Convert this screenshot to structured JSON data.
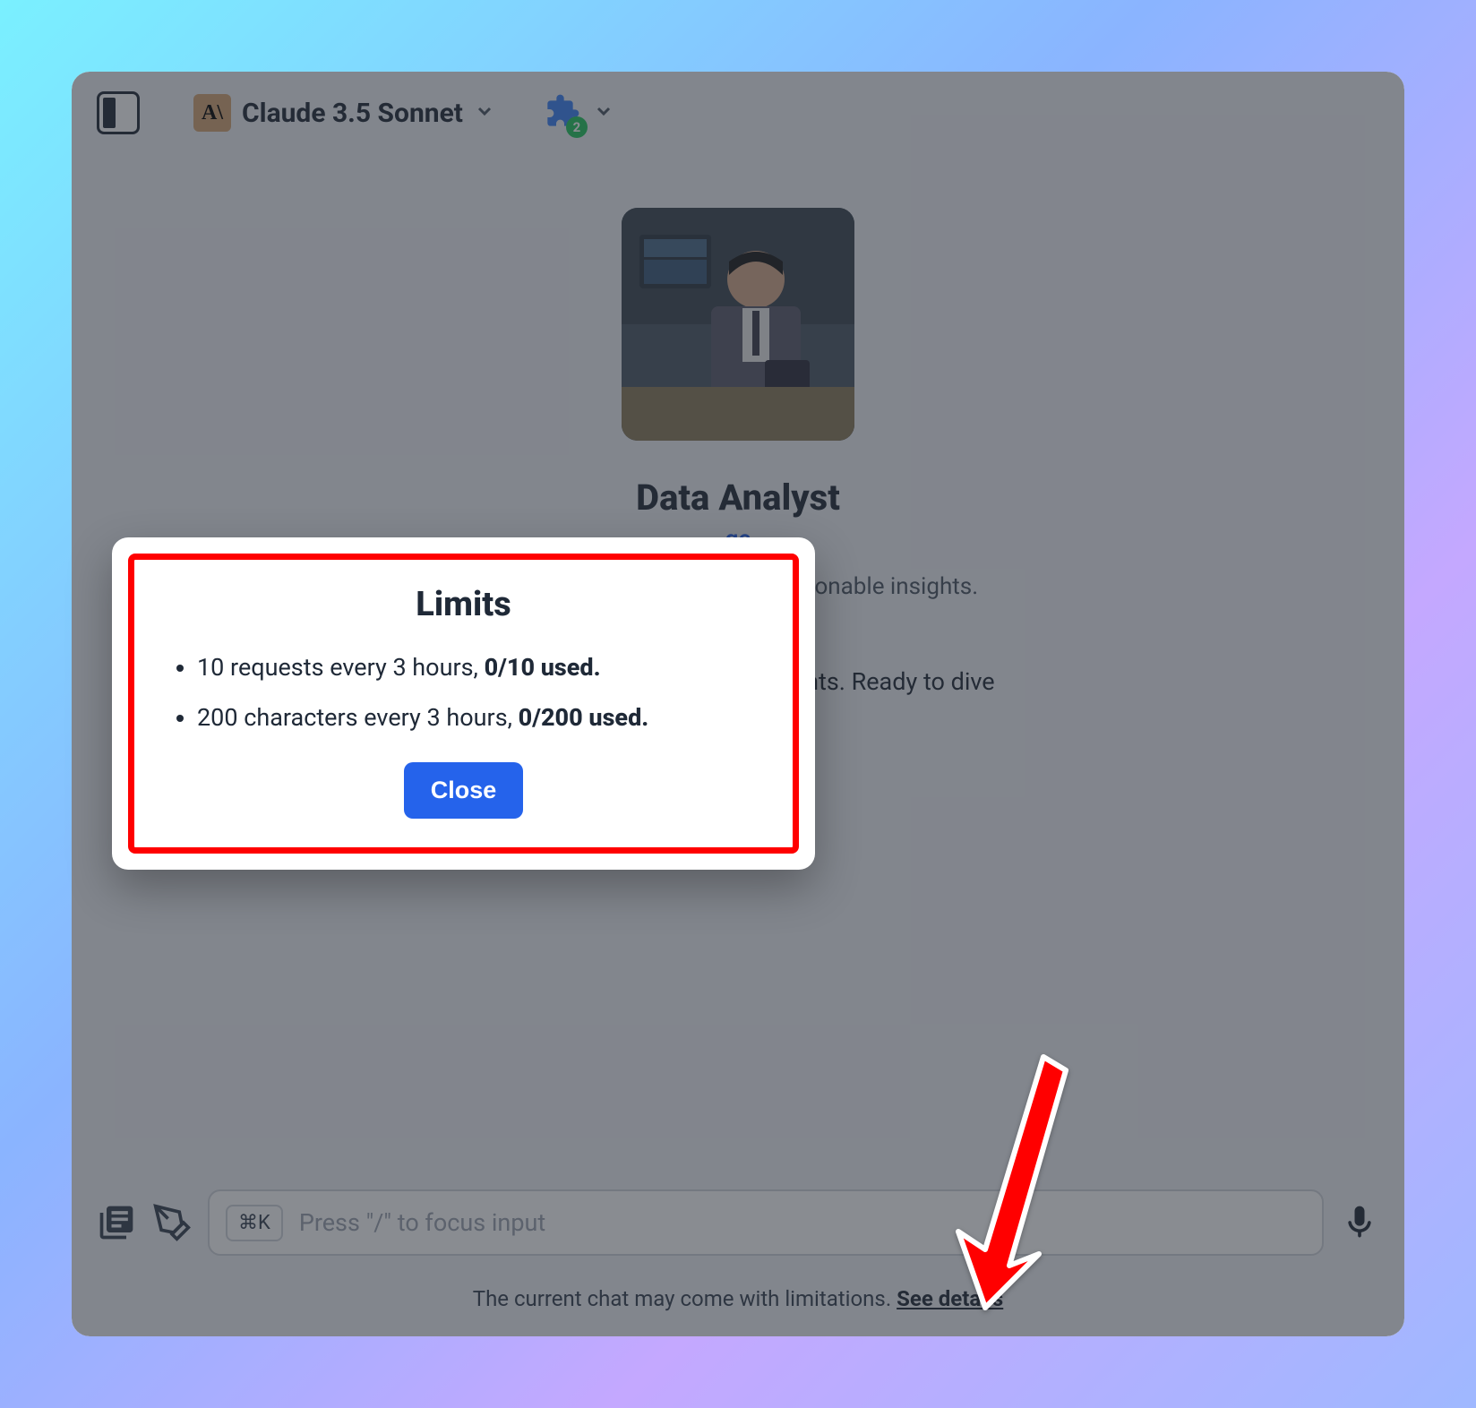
{
  "header": {
    "model_name": "Claude 3.5 Sonnet",
    "model_logo_text": "A\\",
    "plugin_count": "2"
  },
  "agent": {
    "name": "Data Analyst",
    "link_text": "ge",
    "description": "tation, statistical analysis, and onable insights.",
    "intro": "n your data into powerful insights. Ready to dive"
  },
  "modal": {
    "title": "Limits",
    "limit1_text": "10 requests every 3 hours, ",
    "limit1_used": "0/10 used.",
    "limit2_text": "200 characters every 3 hours, ",
    "limit2_used": "0/200 used.",
    "close_label": "Close"
  },
  "input": {
    "kbd": "⌘K",
    "placeholder": "Press \"/\" to focus input"
  },
  "footer": {
    "limitations_text": "The current chat may come with limitations. ",
    "see_details": "See details"
  }
}
